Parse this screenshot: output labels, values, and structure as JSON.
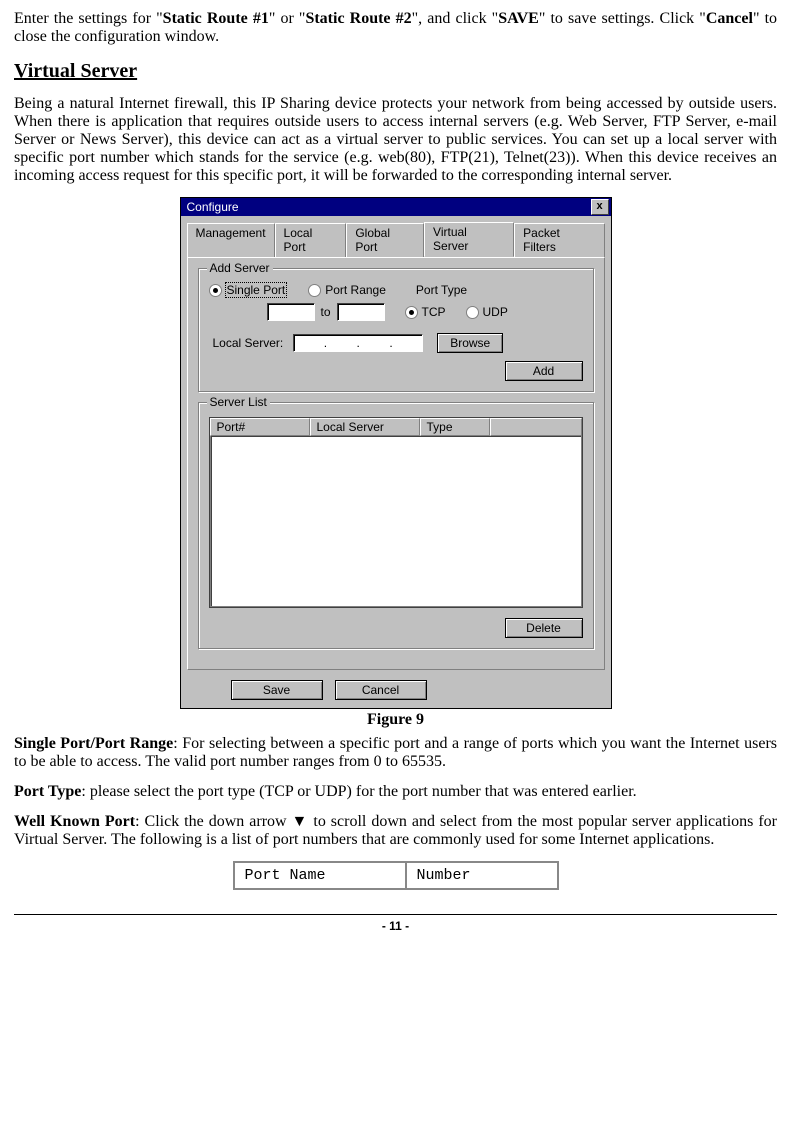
{
  "para1_pre": "Enter the settings for \"",
  "para1_b1": "Static Route #1",
  "para1_mid1": "\" or \"",
  "para1_b2": "Static Route #2",
  "para1_mid2": "\", and click \"",
  "para1_b3": "SAVE",
  "para1_mid3": "\" to save settings. Click \"",
  "para1_b4": "Cancel",
  "para1_post": "\" to close the configuration window.",
  "heading": "Virtual Server",
  "para2": "Being a natural Internet firewall, this IP Sharing device protects your network from being accessed by outside users. When there is application that requires outside users to access internal servers (e.g. Web Server, FTP Server, e-mail Server or News Server), this device can act as a virtual server to public services. You can set up a local server with specific port number which stands for the service (e.g. web(80), FTP(21), Telnet(23)). When this device receives an incoming access request for this specific port, it will be forwarded to the corresponding internal server.",
  "dialog": {
    "title": "Configure",
    "close": "x",
    "tabs": [
      "Management",
      "Local Port",
      "Global Port",
      "Virtual Server",
      "Packet Filters"
    ],
    "addserver": {
      "group": "Add Server",
      "single_port": "Single Port",
      "port_range": "Port Range",
      "port_type": "Port Type",
      "to": "to",
      "tcp": "TCP",
      "udp": "UDP",
      "local_server": "Local Server:",
      "ip_sep": ".",
      "browse": "Browse",
      "add": "Add"
    },
    "serverlist": {
      "group": "Server List",
      "cols": [
        "Port#",
        "Local Server",
        "Type"
      ],
      "delete": "Delete"
    },
    "save": "Save",
    "cancel": "Cancel"
  },
  "fig_caption": "Figure 9",
  "p3_b": "Single Port/Port Range",
  "p3_rest": ": For selecting between a specific port and a range of ports which you want the Internet users to be able to access. The valid port number ranges from 0 to 65535.",
  "p4_b": "Port Type",
  "p4_rest": ": please select the port type (TCP or UDP) for the port number that was entered earlier.",
  "p5_b": "Well Known Port",
  "p5_rest": ": Click the down arrow ▼ to scroll down and select from the most popular server applications for Virtual Server.  The following is a list of port numbers that are commonly used for some Internet applications.",
  "table": {
    "c1": "Port Name",
    "c2": "Number"
  },
  "footer": "- 11 -"
}
